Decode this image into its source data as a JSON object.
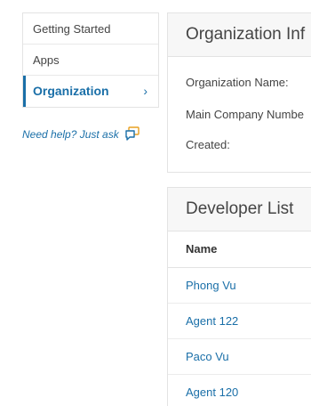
{
  "sidebar": {
    "items": [
      {
        "label": "Getting Started"
      },
      {
        "label": "Apps"
      },
      {
        "label": "Organization",
        "chevron": "›"
      }
    ],
    "help_text": "Need help? Just ask"
  },
  "org_panel": {
    "title": "Organization Inf",
    "fields": {
      "name_label": "Organization Name:",
      "number_label": "Main Company Numbe",
      "created_label": "Created:"
    }
  },
  "dev_panel": {
    "title": "Developer List",
    "column_name": "Name",
    "rows": [
      "Phong Vu",
      "Agent 122",
      "Paco Vu",
      "Agent 120"
    ]
  },
  "colors": {
    "accent": "#1a6fa8",
    "help_icon_accent": "#e8a020"
  }
}
